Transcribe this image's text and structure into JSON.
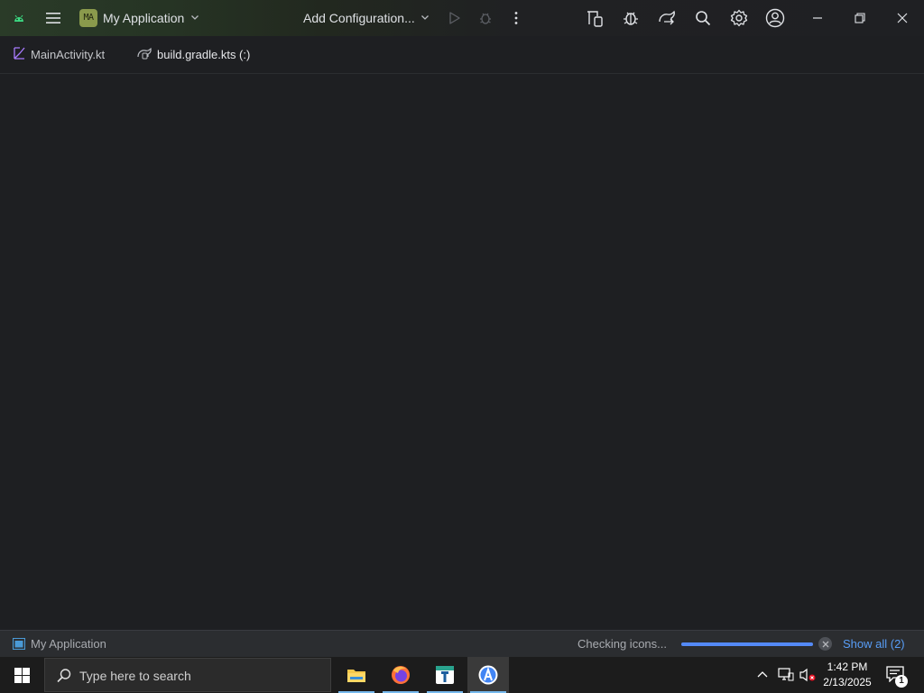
{
  "titlebar": {
    "project_badge": "MA",
    "project_name": "My Application",
    "config_label": "Add Configuration...",
    "icons": [
      "android-icon",
      "hamburger-menu-icon",
      "chevron-down-icon",
      "run-icon",
      "debug-icon",
      "more-vertical-icon",
      "device-manager-icon",
      "app-inspection-icon",
      "sync-gradle-icon",
      "search-icon",
      "gear-icon",
      "account-icon",
      "minimize-icon",
      "restore-icon",
      "close-icon"
    ]
  },
  "tabs": [
    {
      "label": "MainActivity.kt",
      "icon": "kotlin-file-icon",
      "active": false
    },
    {
      "label": "build.gradle.kts (:)",
      "icon": "gradle-file-icon",
      "active": true
    }
  ],
  "statusbar": {
    "project": "My Application",
    "task": "Checking icons...",
    "progress": 1.0,
    "show_all": "Show all (2)"
  },
  "taskbar": {
    "search_placeholder": "Type here to search",
    "apps": [
      "file-explorer-icon",
      "firefox-icon",
      "text-editor-icon",
      "android-studio-icon"
    ],
    "time": "1:42 PM",
    "date": "2/13/2025",
    "notifications": "1"
  },
  "colors": {
    "background": "#1e1f22",
    "accent": "#548af7",
    "link": "#589df6",
    "project_badge": "#8a9a4c"
  }
}
